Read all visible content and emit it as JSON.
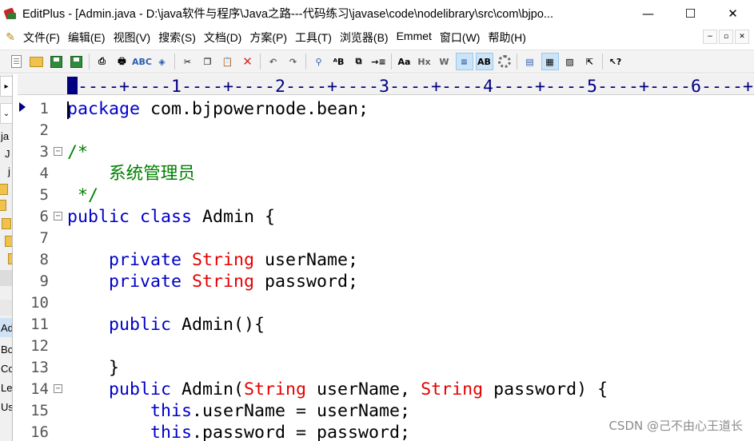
{
  "window": {
    "app_name": "EditPlus",
    "title": "EditPlus - [Admin.java - D:\\java软件与程序\\Java之路---代码练习\\javase\\code\\nodelibrary\\src\\com\\bjpo...",
    "minimize": "—",
    "maximize": "☐",
    "close": "✕"
  },
  "menu": {
    "items": [
      "文件(F)",
      "编辑(E)",
      "视图(V)",
      "搜索(S)",
      "文档(D)",
      "方案(P)",
      "工具(T)",
      "浏览器(B)",
      "Emmet",
      "窗口(W)",
      "帮助(H)"
    ],
    "mdi": [
      "−",
      "▫",
      "✕"
    ]
  },
  "toolbar": {
    "buttons": [
      {
        "name": "new-file-button",
        "icon": "new-doc-icon"
      },
      {
        "name": "open-file-button",
        "icon": "folder-icon"
      },
      {
        "name": "save-button",
        "icon": "save-icon"
      },
      {
        "name": "save-all-button",
        "icon": "save-all-icon"
      },
      {
        "sep": true
      },
      {
        "name": "print-preview-button",
        "icon": "print-preview-icon"
      },
      {
        "name": "print-button",
        "icon": "printer-icon"
      },
      {
        "name": "spell-check-button",
        "icon": "spell-check-icon"
      },
      {
        "name": "browser-button",
        "icon": "browser-icon"
      },
      {
        "sep": true
      },
      {
        "name": "cut-button",
        "icon": "scissors-icon"
      },
      {
        "name": "copy-button",
        "icon": "copy-icon"
      },
      {
        "name": "paste-button",
        "icon": "paste-icon"
      },
      {
        "name": "delete-button",
        "icon": "delete-icon"
      },
      {
        "sep": true
      },
      {
        "name": "undo-button",
        "icon": "undo-icon"
      },
      {
        "name": "redo-button",
        "icon": "redo-icon"
      },
      {
        "sep": true
      },
      {
        "name": "find-button",
        "icon": "find-icon"
      },
      {
        "name": "replace-button",
        "icon": "replace-icon"
      },
      {
        "name": "find-in-files-button",
        "icon": "find-in-files-icon"
      },
      {
        "name": "goto-line-button",
        "icon": "goto-line-icon"
      },
      {
        "sep": true
      },
      {
        "name": "font-button",
        "icon": "font-icon"
      },
      {
        "name": "hex-button",
        "icon": "hex-icon"
      },
      {
        "name": "word-wrap-button",
        "icon": "word-wrap-icon"
      },
      {
        "name": "line-number-button",
        "icon": "line-number-icon",
        "active": true
      },
      {
        "name": "ruler-button",
        "icon": "ruler-icon",
        "active": true
      },
      {
        "name": "preferences-button",
        "icon": "gear-icon"
      },
      {
        "sep": true
      },
      {
        "name": "window-list-button",
        "icon": "window-list-icon"
      },
      {
        "name": "cliptext-button",
        "icon": "cliptext-icon",
        "active": true
      },
      {
        "name": "dir-window-button",
        "icon": "dir-window-icon"
      },
      {
        "name": "fullscreen-button",
        "icon": "fullscreen-icon"
      },
      {
        "sep": true
      },
      {
        "name": "help-button",
        "icon": "help-icon"
      }
    ]
  },
  "toolbar_glyphs": {
    "print-preview-icon": "⎙",
    "printer-icon": "🖶",
    "spell-check-icon": "ABC",
    "browser-icon": "◈",
    "scissors-icon": "✂",
    "copy-icon": "❐",
    "paste-icon": "📋",
    "delete-icon": "✕",
    "undo-icon": "↶",
    "redo-icon": "↷",
    "find-icon": "⚲",
    "replace-icon": "ᴬB",
    "find-in-files-icon": "⧉",
    "goto-line-icon": "→≡",
    "font-icon": "Aa",
    "hex-icon": "Hx",
    "word-wrap-icon": "W",
    "line-number-icon": "≡",
    "ruler-icon": "AB",
    "window-list-icon": "▤",
    "cliptext-icon": "▦",
    "dir-window-icon": "▨",
    "fullscreen-icon": "⇱",
    "help-icon": "↖?"
  },
  "left_panel": {
    "texts": [
      "ja",
      "J",
      "j",
      "Ad",
      "Bo",
      "Co",
      "Le",
      "Us"
    ]
  },
  "ruler": {
    "text": "-----+----1----+----2----+----3----+----4----+----5----+----6----+-"
  },
  "editor": {
    "lines": [
      {
        "n": "1",
        "fold": "",
        "tokens": [
          {
            "t": "package",
            "c": "kw"
          },
          {
            "t": " com.bjpowernode.bean;",
            "c": "pl"
          }
        ]
      },
      {
        "n": "2",
        "fold": "",
        "tokens": []
      },
      {
        "n": "3",
        "fold": "⊟",
        "tokens": [
          {
            "t": "/*",
            "c": "cm"
          }
        ]
      },
      {
        "n": "4",
        "fold": "",
        "tokens": [
          {
            "t": "    系统管理员",
            "c": "cm"
          }
        ]
      },
      {
        "n": "5",
        "fold": "",
        "tokens": [
          {
            "t": " */",
            "c": "cm"
          }
        ]
      },
      {
        "n": "6",
        "fold": "⊟",
        "tokens": [
          {
            "t": "public class",
            "c": "kw"
          },
          {
            "t": " Admin {",
            "c": "pl"
          }
        ]
      },
      {
        "n": "7",
        "fold": "",
        "tokens": []
      },
      {
        "n": "8",
        "fold": "",
        "tokens": [
          {
            "t": "    private ",
            "c": "kw"
          },
          {
            "t": "String",
            "c": "ty"
          },
          {
            "t": " userName;",
            "c": "pl"
          }
        ]
      },
      {
        "n": "9",
        "fold": "",
        "tokens": [
          {
            "t": "    private ",
            "c": "kw"
          },
          {
            "t": "String",
            "c": "ty"
          },
          {
            "t": " password;",
            "c": "pl"
          }
        ]
      },
      {
        "n": "10",
        "fold": "",
        "tokens": []
      },
      {
        "n": "11",
        "fold": "",
        "tokens": [
          {
            "t": "    public",
            "c": "kw"
          },
          {
            "t": " Admin(){",
            "c": "pl"
          }
        ]
      },
      {
        "n": "12",
        "fold": "",
        "tokens": []
      },
      {
        "n": "13",
        "fold": "",
        "tokens": [
          {
            "t": "    }",
            "c": "pl"
          }
        ]
      },
      {
        "n": "14",
        "fold": "⊟",
        "tokens": [
          {
            "t": "    public",
            "c": "kw"
          },
          {
            "t": " Admin(",
            "c": "pl"
          },
          {
            "t": "String",
            "c": "ty"
          },
          {
            "t": " userName, ",
            "c": "pl"
          },
          {
            "t": "String",
            "c": "ty"
          },
          {
            "t": " password) {",
            "c": "pl"
          }
        ]
      },
      {
        "n": "15",
        "fold": "",
        "tokens": [
          {
            "t": "        this",
            "c": "kw"
          },
          {
            "t": ".userName = userName;",
            "c": "pl"
          }
        ]
      },
      {
        "n": "16",
        "fold": "",
        "tokens": [
          {
            "t": "        this",
            "c": "kw"
          },
          {
            "t": ".password = password;",
            "c": "pl"
          }
        ]
      }
    ]
  },
  "watermark": "CSDN @己不由心王道长",
  "colors": {
    "keyword": "#0000c8",
    "type": "#e60000",
    "comment": "#008000",
    "ruler": "#000080"
  }
}
